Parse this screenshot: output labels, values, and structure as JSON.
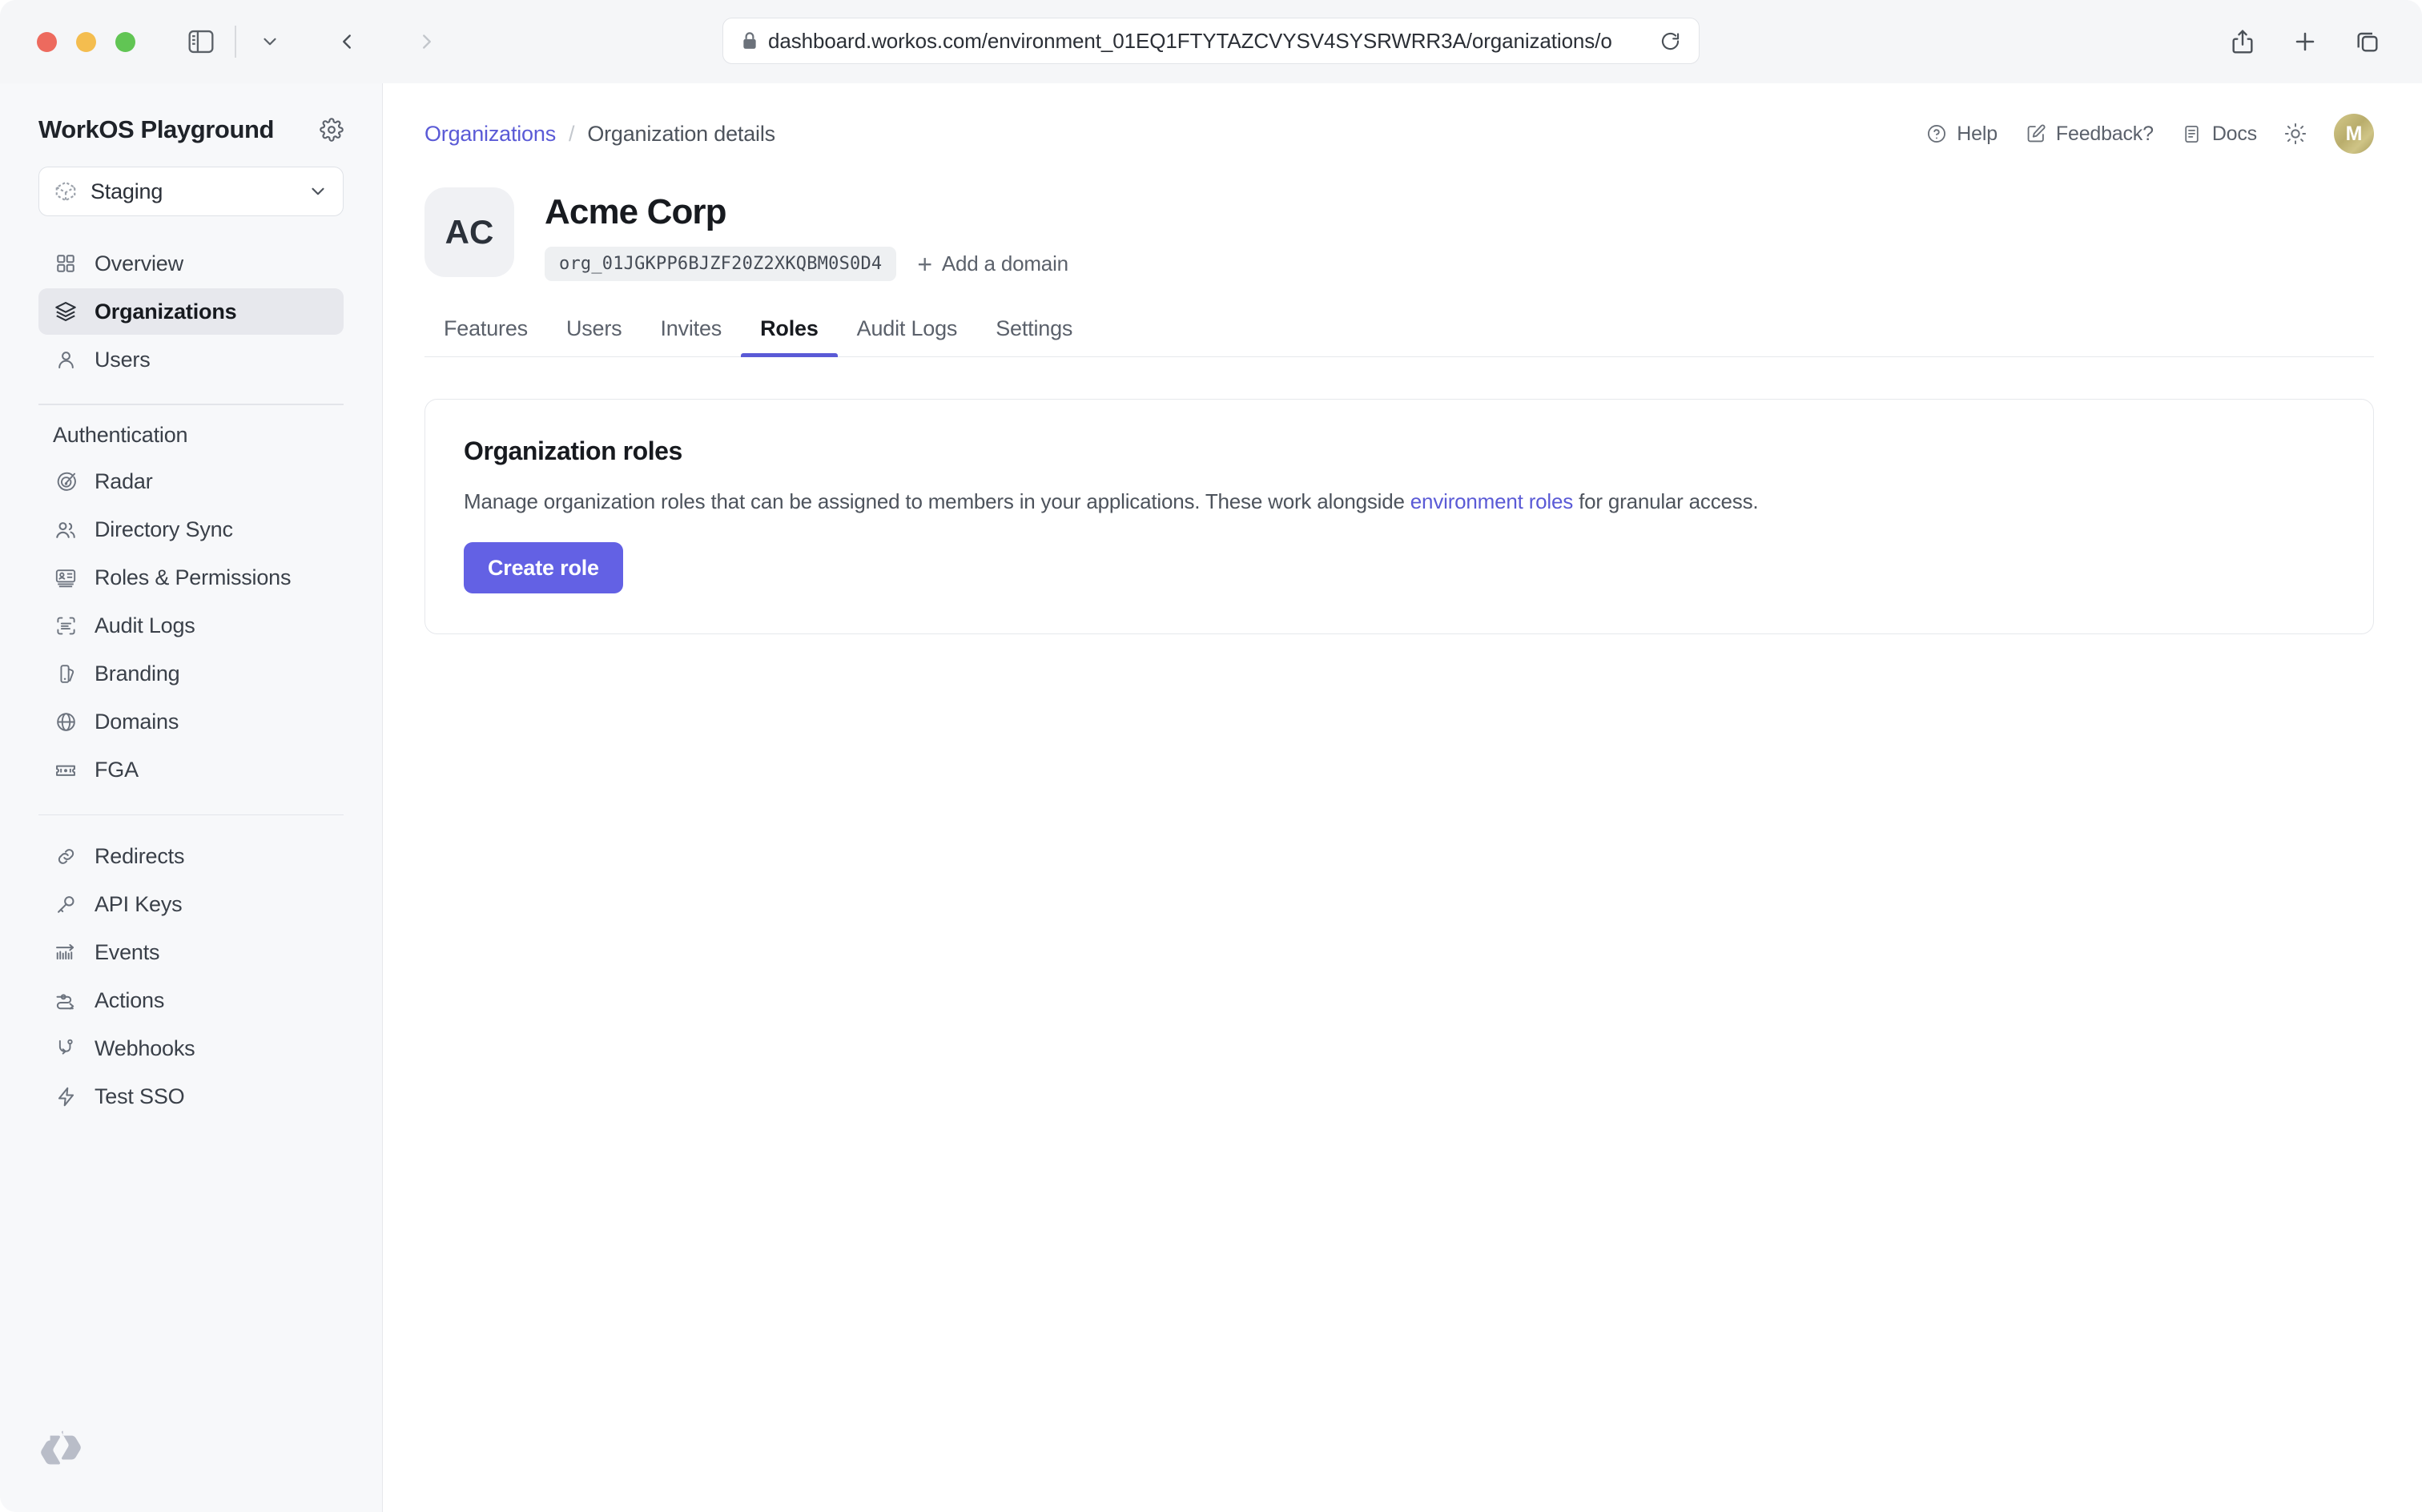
{
  "browser": {
    "url": "dashboard.workos.com/environment_01EQ1FTYTAZCVYSV4SYSRWRR3A/organizations/o",
    "lock_icon": "lock-icon",
    "reload_icon": "reload-icon",
    "sidebar_toggle_icon": "sidebar-toggle-icon",
    "tab_overview_chevron_icon": "chevron-down-icon",
    "back_icon": "chevron-left-icon",
    "forward_icon": "chevron-right-icon",
    "share_icon": "share-icon",
    "new_tab_icon": "plus-icon",
    "tabs_icon": "tab-overview-icon"
  },
  "sidebar": {
    "app_title": "WorkOS Playground",
    "settings_icon": "gear-icon",
    "environment": {
      "name": "Staging",
      "icon": "cube-icon",
      "chevron_icon": "chevron-down-icon"
    },
    "primary_items": [
      {
        "label": "Overview",
        "icon": "grid-icon",
        "active": false
      },
      {
        "label": "Organizations",
        "icon": "layers-icon",
        "active": true
      },
      {
        "label": "Users",
        "icon": "user-icon",
        "active": false
      }
    ],
    "section_label": "Authentication",
    "auth_items": [
      {
        "label": "Radar",
        "icon": "radar-icon"
      },
      {
        "label": "Directory Sync",
        "icon": "users-icon"
      },
      {
        "label": "Roles & Permissions",
        "icon": "id-card-icon"
      },
      {
        "label": "Audit Logs",
        "icon": "scan-text-icon"
      },
      {
        "label": "Branding",
        "icon": "palette-icon"
      },
      {
        "label": "Domains",
        "icon": "globe-icon"
      },
      {
        "label": "FGA",
        "icon": "ticket-icon"
      }
    ],
    "tool_items": [
      {
        "label": "Redirects",
        "icon": "link-icon"
      },
      {
        "label": "API Keys",
        "icon": "key-icon"
      },
      {
        "label": "Events",
        "icon": "events-icon"
      },
      {
        "label": "Actions",
        "icon": "actions-icon"
      },
      {
        "label": "Webhooks",
        "icon": "webhook-icon"
      },
      {
        "label": "Test SSO",
        "icon": "bolt-icon"
      }
    ],
    "logo_icon": "workos-logo-icon"
  },
  "header": {
    "breadcrumb": {
      "parent": "Organizations",
      "separator": "/",
      "current": "Organization details"
    },
    "utils": [
      {
        "label": "Help",
        "icon": "help-circle-icon"
      },
      {
        "label": "Feedback?",
        "icon": "edit-square-icon"
      },
      {
        "label": "Docs",
        "icon": "document-icon"
      }
    ],
    "theme_toggle_icon": "sun-icon",
    "avatar_initial": "M"
  },
  "organization": {
    "avatar_initials": "AC",
    "name": "Acme Corp",
    "id": "org_01JGKPP6BJZF20Z2XKQBM0S0D4",
    "add_domain_label": "Add a domain",
    "add_domain_icon": "plus-icon"
  },
  "tabs": [
    {
      "label": "Features",
      "active": false
    },
    {
      "label": "Users",
      "active": false
    },
    {
      "label": "Invites",
      "active": false
    },
    {
      "label": "Roles",
      "active": true
    },
    {
      "label": "Audit Logs",
      "active": false
    },
    {
      "label": "Settings",
      "active": false
    }
  ],
  "roles_card": {
    "title": "Organization roles",
    "description_before": "Manage organization roles that can be assigned to members in your applications. These work alongside ",
    "description_link": "environment roles",
    "description_after": " for granular access.",
    "create_button_label": "Create role"
  },
  "colors": {
    "accent": "#5a5ad6",
    "button": "#6361e4",
    "sidebar_bg": "#f7f8fa",
    "active_nav_bg": "#e7e8ed",
    "border": "#e6e8ec"
  }
}
